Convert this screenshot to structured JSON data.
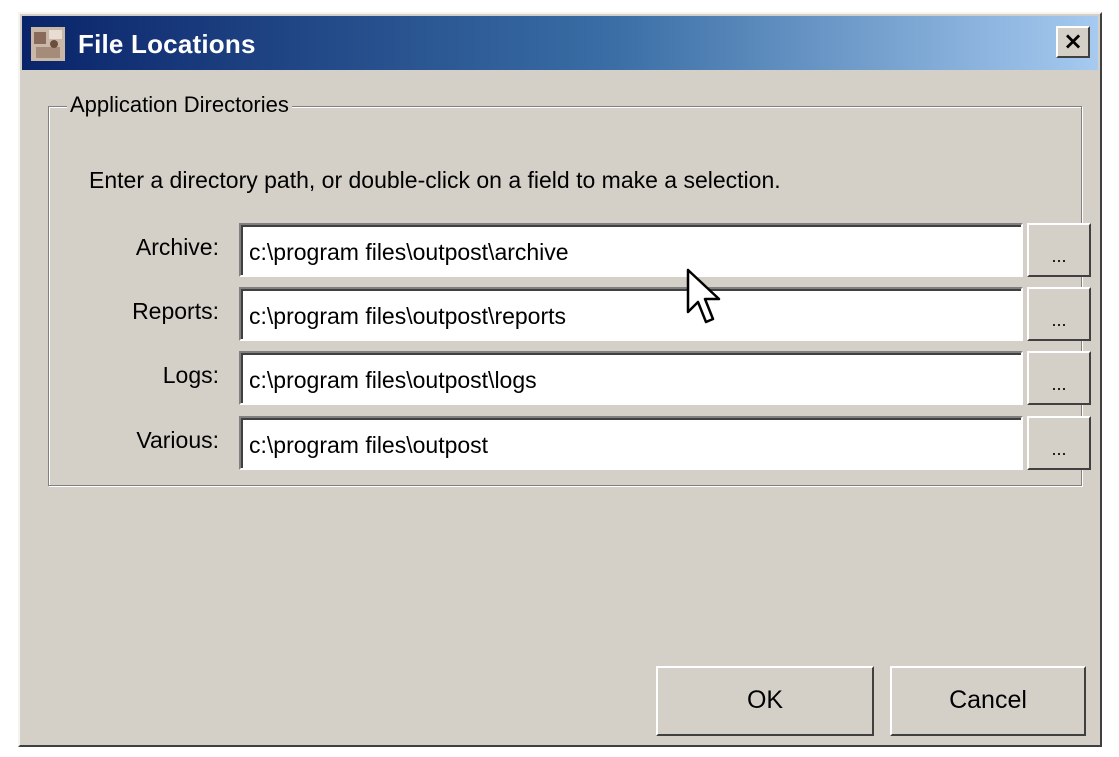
{
  "window": {
    "title": "File Locations",
    "close_label": "×"
  },
  "group": {
    "legend": "Application Directories",
    "hint": "Enter a directory path, or double-click on a field to make a selection."
  },
  "fields": [
    {
      "label": "Archive:",
      "value": "c:\\program files\\outpost\\archive"
    },
    {
      "label": "Reports:",
      "value": "c:\\program files\\outpost\\reports"
    },
    {
      "label": "Logs:",
      "value": "c:\\program files\\outpost\\logs"
    },
    {
      "label": "Various:",
      "value": "c:\\program files\\outpost"
    }
  ],
  "browse_label": "...",
  "buttons": {
    "ok": "OK",
    "cancel": "Cancel"
  },
  "icons": {
    "app": "app-icon",
    "cursor": "mouse-pointer-icon"
  }
}
